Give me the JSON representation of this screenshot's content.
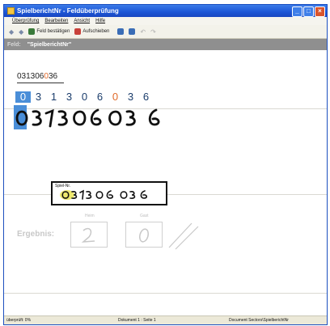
{
  "window": {
    "title": "SpielberichtNr - Feldüberprüfung"
  },
  "menu": [
    "Überprüfung",
    "Bearbeiten",
    "Ansicht",
    "Hilfe"
  ],
  "toolbar": {
    "confirm_label": "Feld bestätigen",
    "cancel_label": "Aufschieben"
  },
  "field": {
    "label": "Feld:",
    "name": "\"SpielberichtNr\""
  },
  "value": {
    "prefix": "031306",
    "highlight": "0",
    "suffix": "36"
  },
  "digits": [
    {
      "char": "0",
      "selected": true,
      "orange": false
    },
    {
      "char": "3",
      "selected": false,
      "orange": false
    },
    {
      "char": "1",
      "selected": false,
      "orange": false
    },
    {
      "char": "3",
      "selected": false,
      "orange": false
    },
    {
      "char": "0",
      "selected": false,
      "orange": false
    },
    {
      "char": "6",
      "selected": false,
      "orange": false
    },
    {
      "char": "0",
      "selected": false,
      "orange": true
    },
    {
      "char": "3",
      "selected": false,
      "orange": false
    },
    {
      "char": "6",
      "selected": false,
      "orange": false
    }
  ],
  "snippet": {
    "tag": "Spiel-Nr."
  },
  "result": {
    "label": "Ergebnis:",
    "home_label": "Heim",
    "guest_label": "Gast"
  },
  "status": {
    "checked": "überprüft: 0%",
    "document": "Dokument 1 : Seite 1",
    "section": "Document Sectors\\SpielberichtNr"
  }
}
